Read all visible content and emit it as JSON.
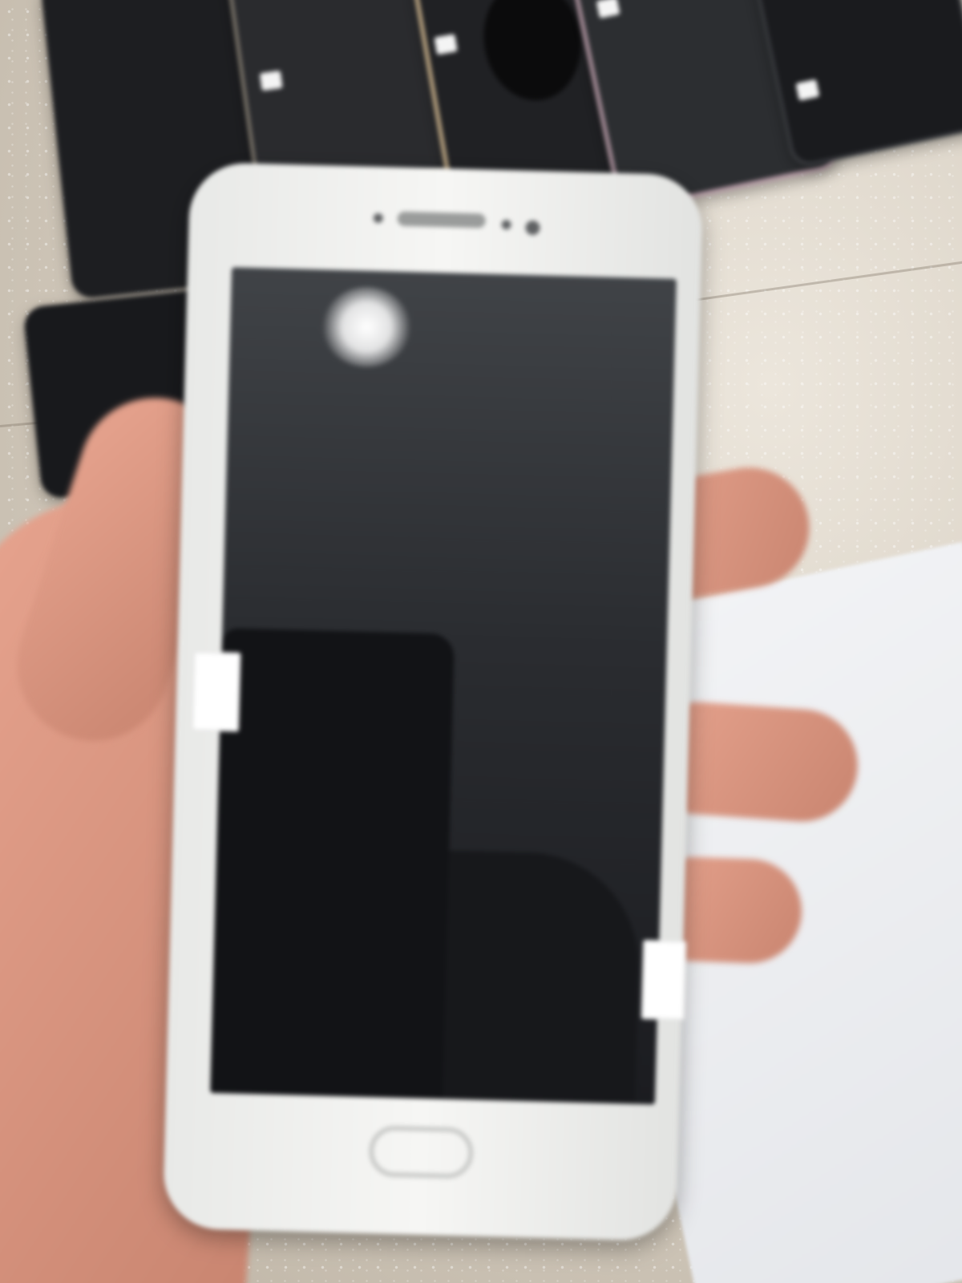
{
  "scene": {
    "description_free": true,
    "colors": {
      "floor": "#d8d0c3",
      "phone_body": "#f0f0ee",
      "screen": "#2a2c30",
      "skin": "#d8927d",
      "paper": "#eceef1"
    },
    "objects": [
      "hand-holding-phone",
      "white-smartphone",
      "background-phones",
      "speckled-floor",
      "white-paper"
    ]
  }
}
